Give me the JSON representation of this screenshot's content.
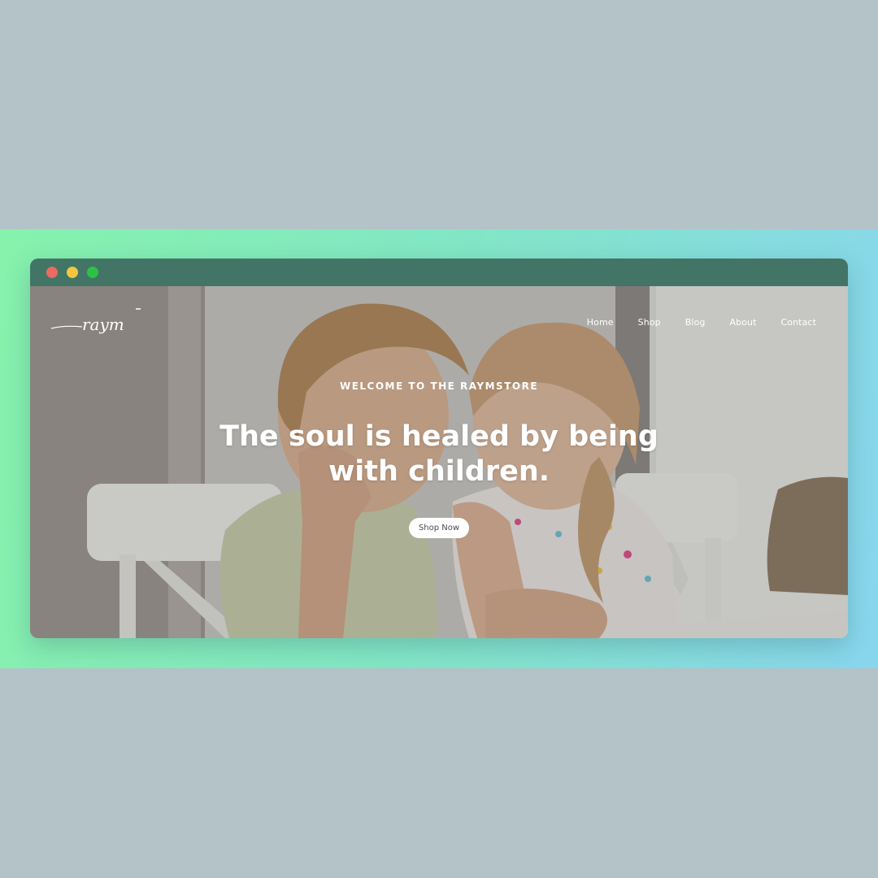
{
  "window": {
    "controls": [
      {
        "name": "close",
        "color": "#ec6a5f"
      },
      {
        "name": "minimize",
        "color": "#f5c53e"
      },
      {
        "name": "maximize",
        "color": "#2cc345"
      }
    ]
  },
  "brand": {
    "logo_text": "raym"
  },
  "nav": {
    "items": [
      "Home",
      "Shop",
      "Blog",
      "About",
      "Contact"
    ]
  },
  "hero": {
    "eyebrow": "WELCOME TO THE RAYMSTORE",
    "headline_line1": "The soul is healed by being",
    "headline_line2": "with children.",
    "cta_label": "Shop Now",
    "image_subject": "two children sitting at a table, cheek to cheek"
  },
  "colors": {
    "background": "#b4c3c7",
    "gradient_start": "#86f2ac",
    "gradient_end": "#88d6ee",
    "titlebar": "#427566"
  }
}
